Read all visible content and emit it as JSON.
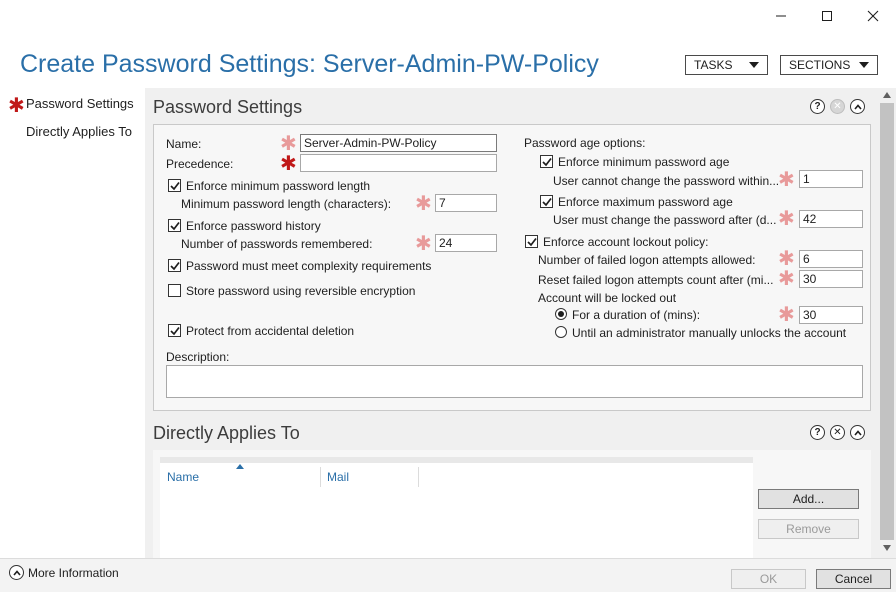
{
  "window": {
    "title": "Create Password Settings: Server-Admin-PW-Policy",
    "tasks_label": "TASKS",
    "sections_label": "SECTIONS"
  },
  "nav": {
    "items": [
      {
        "label": "Password Settings",
        "required": true
      },
      {
        "label": "Directly Applies To",
        "required": false
      }
    ]
  },
  "password_settings": {
    "title": "Password Settings",
    "help_icon": "?",
    "name_label": "Name:",
    "name_value": "Server-Admin-PW-Policy",
    "precedence_label": "Precedence:",
    "precedence_value": "",
    "enforce_min_length": {
      "label": "Enforce minimum password length",
      "checked": true
    },
    "min_length_label": "Minimum password length (characters):",
    "min_length_value": "7",
    "enforce_history": {
      "label": "Enforce password history",
      "checked": true
    },
    "history_label": "Number of passwords remembered:",
    "history_value": "24",
    "complexity": {
      "label": "Password must meet complexity requirements",
      "checked": true
    },
    "reversible": {
      "label": "Store password using reversible encryption",
      "checked": false
    },
    "protect": {
      "label": "Protect from accidental deletion",
      "checked": true
    },
    "description_label": "Description:",
    "description_value": "",
    "age_options_label": "Password age options:",
    "enforce_min_age": {
      "label": "Enforce minimum password age",
      "checked": true
    },
    "min_age_label": "User cannot change the password within...",
    "min_age_value": "1",
    "enforce_max_age": {
      "label": "Enforce maximum password age",
      "checked": true
    },
    "max_age_label": "User must change the password after (d...",
    "max_age_value": "42",
    "lockout": {
      "label": "Enforce account lockout policy:",
      "checked": true
    },
    "failed_attempts_label": "Number of failed logon attempts allowed:",
    "failed_attempts_value": "6",
    "reset_label": "Reset failed logon attempts count after (mi...",
    "reset_value": "30",
    "locked_out_label": "Account will be locked out",
    "duration_radio": {
      "label": "For a duration of (mins):",
      "selected": true
    },
    "duration_value": "30",
    "admin_radio": {
      "label": "Until an administrator manually unlocks the account",
      "selected": false
    }
  },
  "directly_applies": {
    "title": "Directly Applies To",
    "help_icon": "?",
    "columns": [
      "Name",
      "Mail"
    ],
    "add_label": "Add...",
    "remove_label": "Remove"
  },
  "footer": {
    "more_info_label": "More Information",
    "ok_label": "OK",
    "cancel_label": "Cancel"
  },
  "colors": {
    "title_blue": "#2a6fa8",
    "required_red": "#c01818",
    "required_light": "#e89a9a"
  }
}
